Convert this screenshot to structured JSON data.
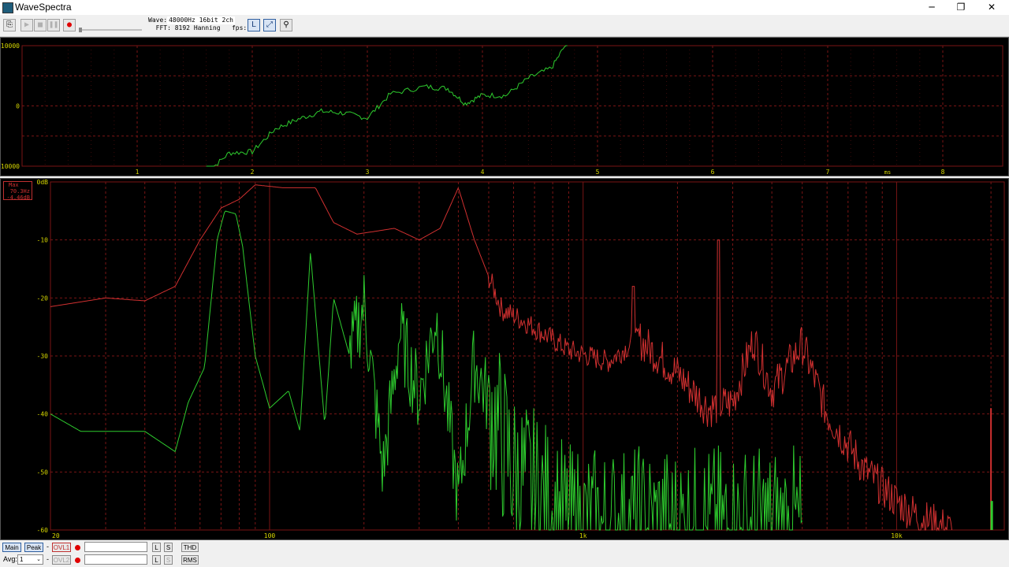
{
  "window": {
    "title": "WaveSpectra",
    "min": "─",
    "restore": "❐",
    "close": "✕"
  },
  "toolbar": {
    "wave_label": "Wave:",
    "wave_value": "48000Hz 16bit 2ch",
    "fft_label": "FFT:",
    "fft_value": "8192 Hanning",
    "fps_label": "fps:",
    "fps_value": "",
    "buttons": [
      "settings-icon",
      "play-icon",
      "stop-icon",
      "pause-icon",
      "record-icon",
      "lr-icon",
      "scale-icon",
      "zoom-icon"
    ]
  },
  "wave": {
    "y_labels": [
      "10000",
      "0",
      "-10000"
    ],
    "x_labels": [
      "1",
      "2",
      "3",
      "4",
      "5",
      "6",
      "7",
      "8"
    ],
    "x_unit": "ms",
    "colors": {
      "grid": "#7a1515",
      "trace": "#2ecc2e",
      "text": "#d6d600"
    }
  },
  "spectrum": {
    "readout": {
      "label": "Max",
      "freq": "70.3Hz",
      "level": "-4.46dB"
    },
    "y_labels": [
      "0dB",
      "-10",
      "-20",
      "-30",
      "-40",
      "-50",
      "-60"
    ],
    "x_labels": [
      "20",
      "100",
      "1k",
      "10k"
    ],
    "colors": {
      "grid": "#7a1515",
      "max": "#d03030",
      "cur": "#2ecc2e",
      "text": "#d6d600"
    }
  },
  "bottom": {
    "main": "Main",
    "peak": "Peak",
    "dash": "-",
    "ovl1": "OVL1",
    "ovl2": "OVL2",
    "l": "L",
    "s": "S",
    "thd": "THD",
    "rms": "RMS",
    "avg_label": "Avg:",
    "avg_value": "1"
  }
}
